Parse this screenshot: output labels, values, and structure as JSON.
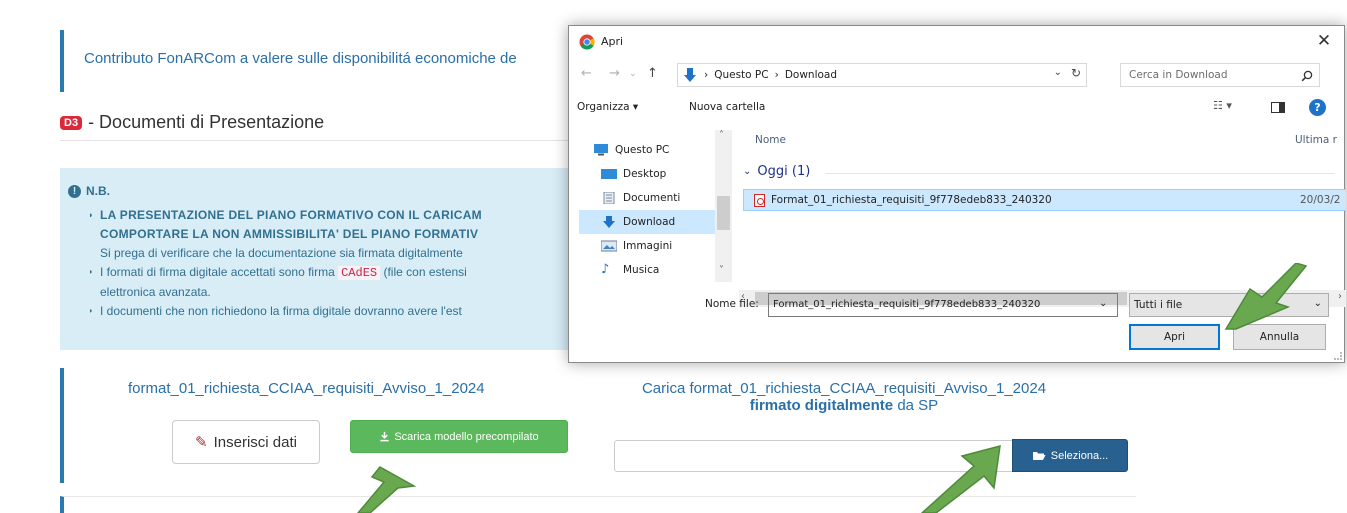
{
  "page": {
    "contrib_text": "Contributo FonARCom a valere sulle disponibilitá economiche de",
    "section_badge": "D3",
    "section_title": "- Documenti di Presentazione",
    "nb": {
      "heading": "N.B.",
      "line1_bold": "LA PRESENTAZIONE DEL PIANO FORMATIVO CON IL CARICAM",
      "line2_bold": "COMPORTARE LA NON AMMISSIBILITA' DEL PIANO FORMATIV",
      "line3": "Si prega di verificare che la documentazione sia firmata digitalmente",
      "line4_pre": "I formati di firma digitale accettati sono firma",
      "line4_code": "CAdES",
      "line4_post": "(file con estensi",
      "line5": "elettronica avanzata.",
      "line6": "I documenti che non richiedono la firma digitale dovranno avere l'est"
    },
    "doc_left_title": "format_01_richiesta_CCIAA_requisiti_Avviso_1_2024",
    "inserisci_label": "Inserisci dati",
    "scarica_label": "Scarica modello precompilato",
    "doc_right_title_line1": "Carica format_01_richiesta_CCIAA_requisiti_Avviso_1_2024",
    "doc_right_bold": "firmato digitalmente",
    "doc_right_suffix": " da SP",
    "seleziona_label": "Seleziona..."
  },
  "dialog": {
    "title": "Apri",
    "close_glyph": "✕",
    "breadcrumb": [
      "Questo PC",
      "Download"
    ],
    "breadcrumb_sep": "›",
    "search_placeholder": "Cerca in Download",
    "organizza_label": "Organizza ▾",
    "nuova_cartella_label": "Nuova cartella",
    "help_label": "?",
    "nav_items": [
      {
        "label": "Questo PC",
        "icon": "pc-icon"
      },
      {
        "label": "Desktop",
        "icon": "desktop-icon"
      },
      {
        "label": "Documenti",
        "icon": "documents-icon"
      },
      {
        "label": "Download",
        "icon": "download-icon"
      },
      {
        "label": "Immagini",
        "icon": "pictures-icon"
      },
      {
        "label": "Musica",
        "icon": "music-icon"
      }
    ],
    "selected_nav": "Download",
    "col_name": "Nome",
    "col_date": "Ultima r",
    "group_label": "Oggi (1)",
    "file": {
      "name": "Format_01_richiesta_requisiti_9f778edeb833_240320",
      "date": "20/03/2"
    },
    "filename_label": "Nome file:",
    "filename_value": "Format_01_richiesta_requisiti_9f778edeb833_240320",
    "filetype_value": "Tutti i file",
    "open_label": "Apri",
    "cancel_label": "Annulla"
  },
  "colors": {
    "accent_blue": "#2a7ab0",
    "green_button": "#5cb85c",
    "primary_button": "#286090",
    "arrow_green": "#6aa84f",
    "selection": "#cce8ff"
  }
}
